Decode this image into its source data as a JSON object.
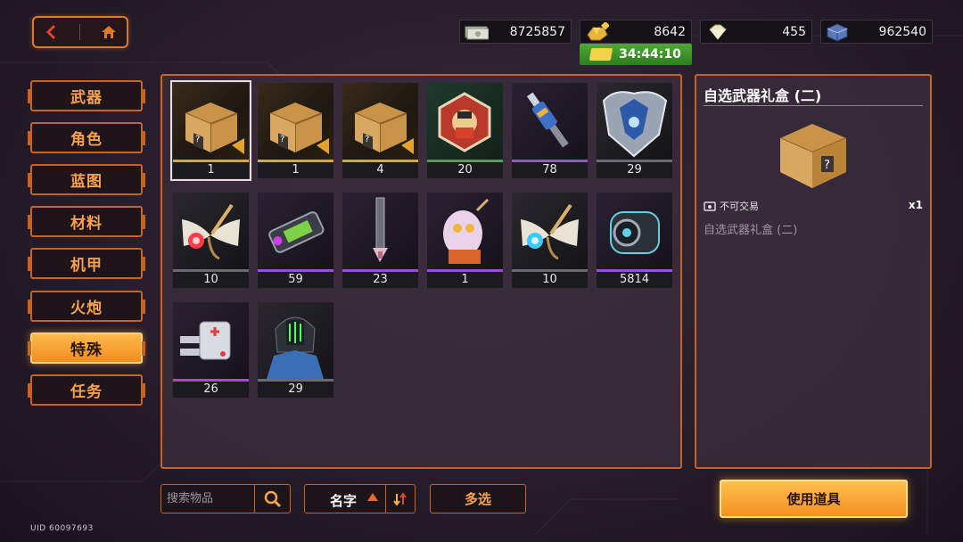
{
  "currencies": [
    {
      "icon": "cash-icon",
      "value": "8725857"
    },
    {
      "icon": "gold-bars-icon",
      "value": "8642"
    },
    {
      "icon": "diamond-icon",
      "value": "455"
    },
    {
      "icon": "blue-cube-icon",
      "value": "962540"
    }
  ],
  "timer": {
    "icon": "ticket-icon",
    "value": "34:44:10"
  },
  "tabs": [
    "武器",
    "角色",
    "蓝图",
    "材料",
    "机甲",
    "火炮",
    "特殊",
    "任务"
  ],
  "active_tab": "特殊",
  "inventory": [
    {
      "name": "mystery-box-gold",
      "count": "1",
      "rarity": "gold",
      "selected": true
    },
    {
      "name": "mystery-box-gold",
      "count": "1",
      "rarity": "gold"
    },
    {
      "name": "mystery-box-gold",
      "count": "4",
      "rarity": "gold"
    },
    {
      "name": "hex-badge-item",
      "count": "20",
      "rarity": "green"
    },
    {
      "name": "spark-plug-item",
      "count": "78",
      "rarity": "purple"
    },
    {
      "name": "mech-armor-item",
      "count": "29",
      "rarity": "grey"
    },
    {
      "name": "mech-insect-red",
      "count": "10",
      "rarity": "grey"
    },
    {
      "name": "battery-cell-item",
      "count": "59",
      "rarity": "purple"
    },
    {
      "name": "dagger-item",
      "count": "23",
      "rarity": "purple"
    },
    {
      "name": "robot-head-item",
      "count": "1",
      "rarity": "purple"
    },
    {
      "name": "mech-insect-blue",
      "count": "10",
      "rarity": "grey"
    },
    {
      "name": "fuel-canister-item",
      "count": "5814",
      "rarity": "purple"
    },
    {
      "name": "medkit-item",
      "count": "26",
      "rarity": "purple"
    },
    {
      "name": "robot-pilot-item",
      "count": "29",
      "rarity": "grey"
    }
  ],
  "detail": {
    "title": "自选武器礼盒 (二)",
    "tradeable_label": "不可交易",
    "quantity": "x1",
    "description": "自选武器礼盒 (二)"
  },
  "search": {
    "placeholder": "搜索物品"
  },
  "sort": {
    "label": "名字"
  },
  "multi_select_label": "多选",
  "use_button_label": "使用道具",
  "uid_label": "UID 60097693",
  "colors": {
    "accent": "#c8641f",
    "active_tab": "#f08d21",
    "rarity_gold": "#e3a32c",
    "rarity_green": "#3ea65a",
    "rarity_purple": "#a24bd6",
    "rarity_grey": "#6a6a70"
  }
}
